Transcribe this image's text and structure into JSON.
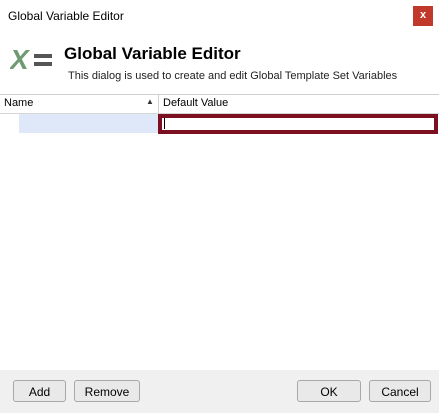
{
  "window": {
    "title": "Global Variable Editor",
    "close_glyph": "x"
  },
  "header": {
    "logo_icon": "variable-x-equals-icon",
    "heading": "Global Variable Editor",
    "subtitle": "This dialog is used to create and edit Global Template Set Variables"
  },
  "grid": {
    "columns": [
      {
        "label": "Name",
        "sort": "ascending"
      },
      {
        "label": "Default Value"
      }
    ],
    "rows": [
      {
        "name": "",
        "default_value": ""
      }
    ],
    "edit_border_color": "#7d1020"
  },
  "footer": {
    "add_label": "Add",
    "remove_label": "Remove",
    "ok_label": "OK",
    "cancel_label": "Cancel"
  }
}
